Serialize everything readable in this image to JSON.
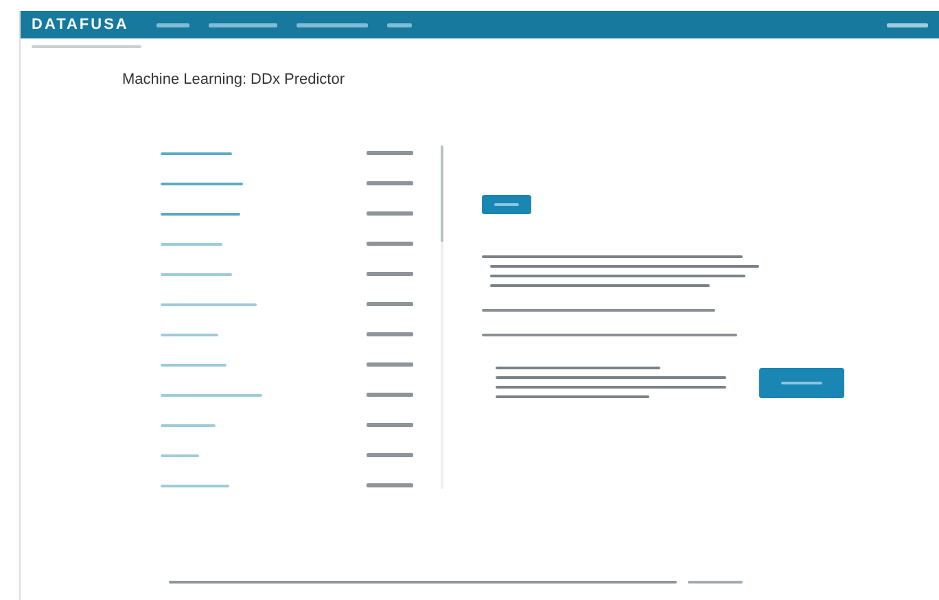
{
  "header": {
    "logo": "DATAFUSA"
  },
  "page": {
    "title": "Machine Learning: DDx Predictor"
  }
}
